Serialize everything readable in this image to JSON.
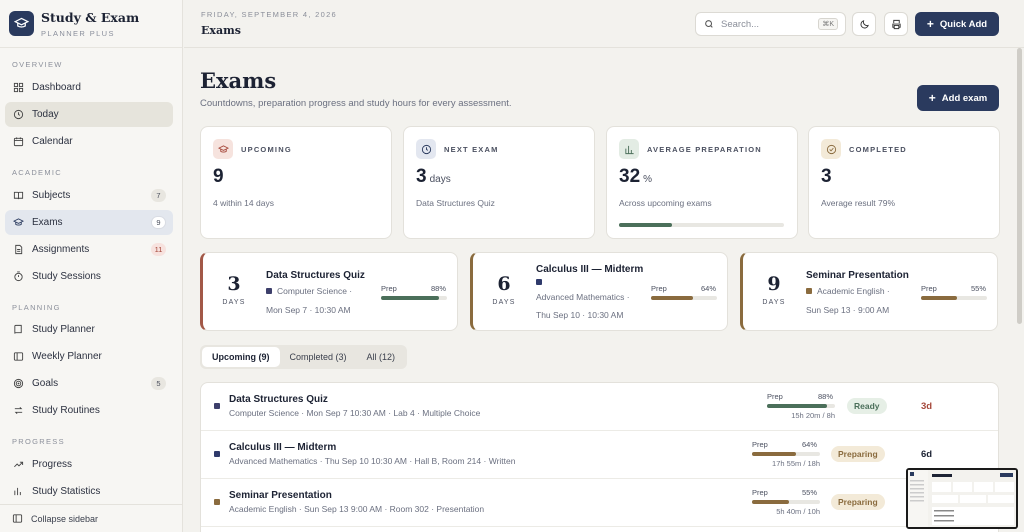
{
  "brand": {
    "title": "Study & Exam",
    "subtitle": "PLANNER PLUS"
  },
  "sidebar": {
    "sections": {
      "overview": "OVERVIEW",
      "academic": "ACADEMIC",
      "planning": "PLANNING",
      "progress": "PROGRESS"
    },
    "items": {
      "dashboard": "Dashboard",
      "today": "Today",
      "calendar": "Calendar",
      "subjects": "Subjects",
      "subjects_count": "7",
      "exams": "Exams",
      "exams_count": "9",
      "assignments": "Assignments",
      "assignments_count": "11",
      "study_sessions": "Study Sessions",
      "study_planner": "Study Planner",
      "weekly_planner": "Weekly Planner",
      "goals": "Goals",
      "goals_count": "5",
      "study_routines": "Study Routines",
      "progress": "Progress",
      "study_statistics": "Study Statistics"
    },
    "collapse": "Collapse sidebar"
  },
  "header": {
    "date": "FRIDAY, SEPTEMBER 4, 2026",
    "title": "Exams",
    "search_placeholder": "Search...",
    "search_kbd": "⌘K",
    "quick_add": "Quick Add"
  },
  "page": {
    "title": "Exams",
    "subtitle": "Countdowns, preparation progress and study hours for every assessment.",
    "add_exam": "Add exam"
  },
  "stats": [
    {
      "label": "UPCOMING",
      "value": "9",
      "unit": "",
      "note": "4 within 14 days"
    },
    {
      "label": "NEXT EXAM",
      "value": "3",
      "unit": "days",
      "note": "Data Structures Quiz"
    },
    {
      "label": "AVERAGE PREPARATION",
      "value": "32",
      "unit": "%",
      "note": "Across upcoming exams",
      "progress": 0.32
    },
    {
      "label": "COMPLETED",
      "value": "3",
      "unit": "",
      "note": "Average result 79%"
    }
  ],
  "countdowns": [
    {
      "days": "3",
      "days_label": "DAYS",
      "name": "Data Structures Quiz",
      "subject": "Computer Science  ·",
      "when": "Mon Sep 7 · 10:30 AM",
      "prep_label": "Prep",
      "prep": "88%",
      "prep_value": 0.88,
      "color": "#4b6f5a",
      "dot": "#3d3f6b"
    },
    {
      "days": "6",
      "days_label": "DAYS",
      "name": "Calculus III — Midterm",
      "subject": "Advanced Mathematics  ·",
      "when": "Thu Sep 10 · 10:30 AM",
      "prep_label": "Prep",
      "prep": "64%",
      "prep_value": 0.64,
      "color": "#8a6b3e",
      "dot": "#2f3a6b"
    },
    {
      "days": "9",
      "days_label": "DAYS",
      "name": "Seminar Presentation",
      "subject": "Academic English  ·",
      "when": "Sun Sep 13 · 9:00 AM",
      "prep_label": "Prep",
      "prep": "55%",
      "prep_value": 0.55,
      "color": "#8a6b3e",
      "dot": "#8a6b3e"
    }
  ],
  "tabs": [
    "Upcoming (9)",
    "Completed (3)",
    "All (12)"
  ],
  "exams": [
    {
      "name": "Data Structures Quiz",
      "meta": "Computer Science  ·  Mon Sep 7 10:30 AM  ·  Lab 4  ·  Multiple Choice",
      "prep_label": "Prep",
      "prep": "88%",
      "prep_value": 0.88,
      "hours": "15h 20m / 8h",
      "status": "Ready",
      "days": "3d",
      "dot": "#3d3f6b",
      "color": "#4b6f5a"
    },
    {
      "name": "Calculus III — Midterm",
      "meta": "Advanced Mathematics  ·  Thu Sep 10 10:30 AM  ·  Hall B, Room 214  ·  Written",
      "prep_label": "Prep",
      "prep": "64%",
      "prep_value": 0.64,
      "hours": "17h 55m / 18h",
      "status": "Preparing",
      "days": "6d",
      "dot": "#2f3a6b",
      "color": "#8a6b3e"
    },
    {
      "name": "Seminar Presentation",
      "meta": "Academic English  ·  Sun Sep 13 9:00 AM  ·  Room 302  ·  Presentation",
      "prep_label": "Prep",
      "prep": "55%",
      "prep_value": 0.55,
      "hours": "5h 40m / 10h",
      "status": "Preparing",
      "days": "",
      "dot": "#8a6b3e",
      "color": "#8a6b3e"
    }
  ],
  "colors": {
    "accent": "#2a3a5e",
    "ready": "#4b6f5a",
    "preparing": "#8a6b3e",
    "urgent": "#a5473a"
  }
}
